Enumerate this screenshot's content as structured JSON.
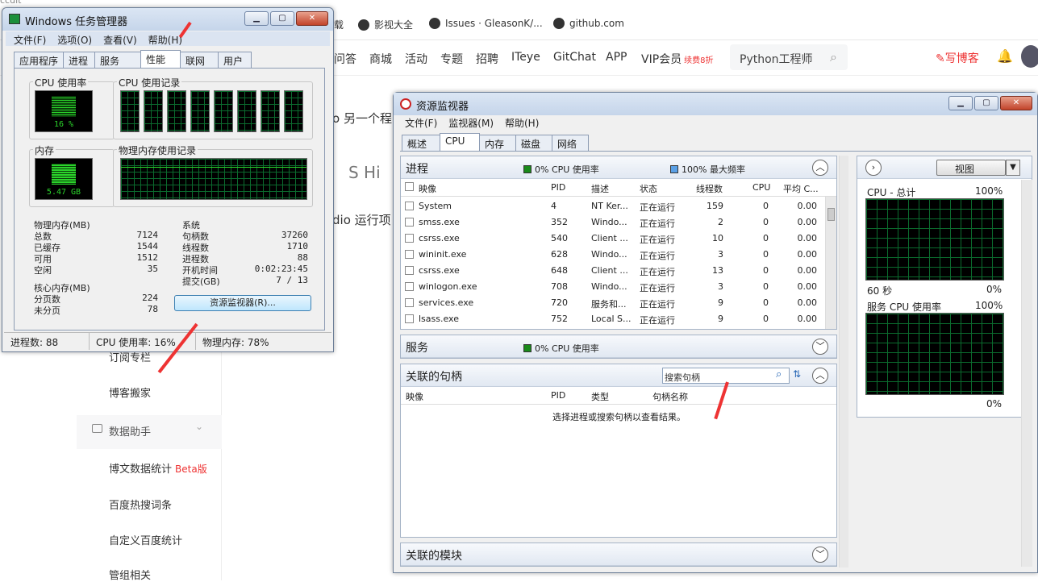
{
  "browser": {
    "top_fragment": "ccdit",
    "bookmarks": [
      "载",
      "影视大全",
      "Issues · GleasonK/...",
      "github.com"
    ],
    "nav": [
      "问答",
      "商城",
      "活动",
      "专题",
      "招聘",
      "ITeye",
      "GitChat",
      "APP",
      "VIP会员"
    ],
    "vip_badge": "续费8折",
    "search_placeholder": "Python工程师",
    "write_label": "写博客",
    "fragments": [
      "o 另一个程",
      "S Hi",
      "dio 运行项"
    ],
    "sidebar": [
      "订阅专栏",
      "博客搬家",
      "数据助手",
      "博文数据统计",
      "百度热搜词条",
      "自定义百度统计",
      "管组相关"
    ],
    "beta": "Beta版"
  },
  "taskmgr": {
    "title": "Windows 任务管理器",
    "menu": [
      "文件(F)",
      "选项(O)",
      "查看(V)",
      "帮助(H)"
    ],
    "tabs": [
      "应用程序",
      "进程",
      "服务",
      "性能",
      "联网",
      "用户"
    ],
    "cpu_usage_label": "CPU 使用率",
    "cpu_usage_value": "16 %",
    "cpu_history_label": "CPU 使用记录",
    "mem_label": "内存",
    "mem_value": "5.47 GB",
    "mem_history_label": "物理内存使用记录",
    "phys_mem": {
      "title": "物理内存(MB)",
      "rows": [
        [
          "总数",
          "7124"
        ],
        [
          "已缓存",
          "1544"
        ],
        [
          "可用",
          "1512"
        ],
        [
          "空闲",
          "35"
        ]
      ]
    },
    "kernel_mem": {
      "title": "核心内存(MB)",
      "rows": [
        [
          "分页数",
          "224"
        ],
        [
          "未分页",
          "78"
        ]
      ]
    },
    "system": {
      "title": "系统",
      "rows": [
        [
          "句柄数",
          "37260"
        ],
        [
          "线程数",
          "1710"
        ],
        [
          "进程数",
          "88"
        ],
        [
          "开机时间",
          "0:02:23:45"
        ],
        [
          "提交(GB)",
          "7 / 13"
        ]
      ]
    },
    "resmon_button": "资源监视器(R)...",
    "status": [
      "进程数: 88",
      "CPU 使用率: 16%",
      "物理内存: 78%"
    ]
  },
  "resmon": {
    "title": "资源监视器",
    "menu": [
      "文件(F)",
      "监视器(M)",
      "帮助(H)"
    ],
    "tabs": [
      "概述",
      "CPU",
      "内存",
      "磁盘",
      "网络"
    ],
    "process": {
      "title": "进程",
      "legend1": "0% CPU 使用率",
      "legend2": "100% 最大频率",
      "headers": [
        "映像",
        "PID",
        "描述",
        "状态",
        "线程数",
        "CPU",
        "平均 C..."
      ],
      "rows": [
        [
          "System",
          "4",
          "NT Ker...",
          "正在运行",
          "159",
          "0",
          "0.00"
        ],
        [
          "smss.exe",
          "352",
          "Windo...",
          "正在运行",
          "2",
          "0",
          "0.00"
        ],
        [
          "csrss.exe",
          "540",
          "Client ...",
          "正在运行",
          "10",
          "0",
          "0.00"
        ],
        [
          "wininit.exe",
          "628",
          "Windo...",
          "正在运行",
          "3",
          "0",
          "0.00"
        ],
        [
          "csrss.exe",
          "648",
          "Client ...",
          "正在运行",
          "13",
          "0",
          "0.00"
        ],
        [
          "winlogon.exe",
          "708",
          "Windo...",
          "正在运行",
          "3",
          "0",
          "0.00"
        ],
        [
          "services.exe",
          "720",
          "服务和...",
          "正在运行",
          "9",
          "0",
          "0.00"
        ],
        [
          "lsass.exe",
          "752",
          "Local S...",
          "正在运行",
          "9",
          "0",
          "0.00"
        ]
      ]
    },
    "services": {
      "title": "服务",
      "legend": "0% CPU 使用率"
    },
    "handles": {
      "title": "关联的句柄",
      "search_placeholder": "搜索句柄",
      "headers": [
        "映像",
        "PID",
        "类型",
        "句柄名称"
      ],
      "empty": "选择进程或搜索句柄以查看结果。"
    },
    "modules": {
      "title": "关联的模块"
    },
    "right": {
      "view_button": "视图",
      "cpu_total": "CPU - 总计",
      "pct_top1": "100%",
      "sixty": "60 秒",
      "pct_bot1": "0%",
      "service_cpu": "服务 CPU 使用率",
      "pct_top2": "100%",
      "pct_bot2": "0%"
    }
  },
  "colors": {
    "accent_red": "#e33333",
    "legend_green": "#1a8a1a",
    "legend_blue": "#5aa0e6"
  }
}
